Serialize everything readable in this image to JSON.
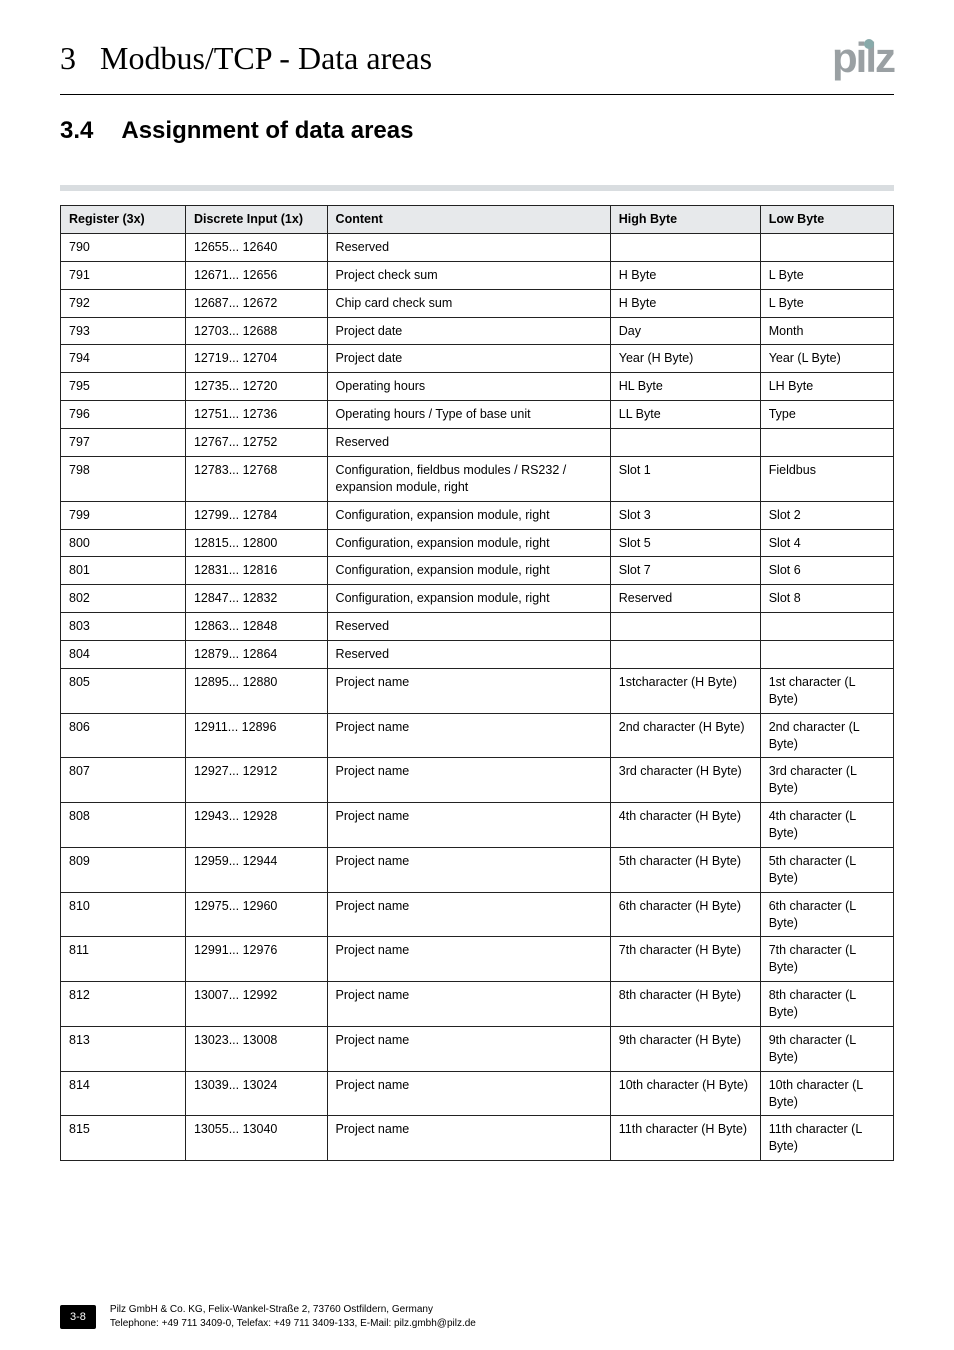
{
  "header": {
    "chapter_number": "3",
    "chapter_title": "Modbus/TCP - Data areas",
    "brand": "pilz"
  },
  "section": {
    "number": "3.4",
    "title": "Assignment of data areas"
  },
  "table": {
    "headers": {
      "register": "Register (3x)",
      "discrete": "Discrete Input (1x)",
      "content": "Content",
      "high": "High Byte",
      "low": "Low Byte"
    },
    "rows": [
      {
        "reg": "790",
        "di": "12655... 12640",
        "content": "Reserved",
        "hb": "",
        "lb": ""
      },
      {
        "reg": "791",
        "di": "12671... 12656",
        "content": "Project check sum",
        "hb": "H Byte",
        "lb": "L Byte"
      },
      {
        "reg": "792",
        "di": "12687... 12672",
        "content": "Chip card check sum",
        "hb": "H Byte",
        "lb": "L Byte"
      },
      {
        "reg": "793",
        "di": "12703... 12688",
        "content": "Project date",
        "hb": "Day",
        "lb": "Month"
      },
      {
        "reg": "794",
        "di": "12719... 12704",
        "content": "Project date",
        "hb": "Year (H Byte)",
        "lb": "Year (L Byte)"
      },
      {
        "reg": "795",
        "di": "12735... 12720",
        "content": "Operating hours",
        "hb": "HL Byte",
        "lb": "LH Byte"
      },
      {
        "reg": "796",
        "di": "12751... 12736",
        "content": "Operating hours / Type of base unit",
        "hb": "LL Byte",
        "lb": "Type"
      },
      {
        "reg": "797",
        "di": "12767... 12752",
        "content": "Reserved",
        "hb": "",
        "lb": ""
      },
      {
        "reg": "798",
        "di": "12783... 12768",
        "content": "Configuration, fieldbus modules / RS232 / expansion module, right",
        "hb": "Slot 1",
        "lb": "Fieldbus"
      },
      {
        "reg": "799",
        "di": "12799... 12784",
        "content": "Configuration, expansion module, right",
        "hb": "Slot 3",
        "lb": "Slot 2"
      },
      {
        "reg": "800",
        "di": "12815... 12800",
        "content": "Configuration, expansion module, right",
        "hb": "Slot 5",
        "lb": "Slot 4"
      },
      {
        "reg": "801",
        "di": "12831... 12816",
        "content": "Configuration, expansion module, right",
        "hb": "Slot 7",
        "lb": "Slot 6"
      },
      {
        "reg": "802",
        "di": "12847... 12832",
        "content": "Configuration, expansion module, right",
        "hb": "Reserved",
        "lb": "Slot 8"
      },
      {
        "reg": "803",
        "di": "12863... 12848",
        "content": "Reserved",
        "hb": "",
        "lb": ""
      },
      {
        "reg": "804",
        "di": "12879... 12864",
        "content": "Reserved",
        "hb": "",
        "lb": ""
      },
      {
        "reg": "805",
        "di": "12895... 12880",
        "content": "Project name",
        "hb": "1stcharacter (H Byte)",
        "lb": "1st character (L Byte)"
      },
      {
        "reg": "806",
        "di": "12911... 12896",
        "content": "Project name",
        "hb": "2nd character (H Byte)",
        "lb": "2nd character (L Byte)"
      },
      {
        "reg": "807",
        "di": "12927... 12912",
        "content": "Project name",
        "hb": "3rd character (H Byte)",
        "lb": "3rd character (L Byte)"
      },
      {
        "reg": "808",
        "di": "12943... 12928",
        "content": "Project name",
        "hb": "4th character (H Byte)",
        "lb": "4th character (L Byte)"
      },
      {
        "reg": "809",
        "di": "12959... 12944",
        "content": "Project name",
        "hb": "5th character (H Byte)",
        "lb": "5th character (L Byte)"
      },
      {
        "reg": "810",
        "di": "12975... 12960",
        "content": "Project name",
        "hb": "6th character (H Byte)",
        "lb": "6th character (L Byte)"
      },
      {
        "reg": "811",
        "di": "12991... 12976",
        "content": "Project name",
        "hb": "7th character (H Byte)",
        "lb": "7th character (L Byte)"
      },
      {
        "reg": "812",
        "di": "13007... 12992",
        "content": "Project name",
        "hb": "8th character (H Byte)",
        "lb": "8th character (L Byte)"
      },
      {
        "reg": "813",
        "di": "13023... 13008",
        "content": "Project name",
        "hb": "9th character (H Byte)",
        "lb": "9th character (L Byte)"
      },
      {
        "reg": "814",
        "di": "13039... 13024",
        "content": "Project name",
        "hb": "10th character (H Byte)",
        "lb": "10th character (L Byte)"
      },
      {
        "reg": "815",
        "di": "13055... 13040",
        "content": "Project name",
        "hb": "11th character (H Byte)",
        "lb": "11th character (L Byte)"
      }
    ]
  },
  "footer": {
    "page": "3-8",
    "line1": "Pilz GmbH & Co. KG, Felix-Wankel-Straße 2, 73760 Ostfildern, Germany",
    "line2": "Telephone: +49 711 3409-0, Telefax: +49 711 3409-133, E-Mail: pilz.gmbh@pilz.de"
  }
}
